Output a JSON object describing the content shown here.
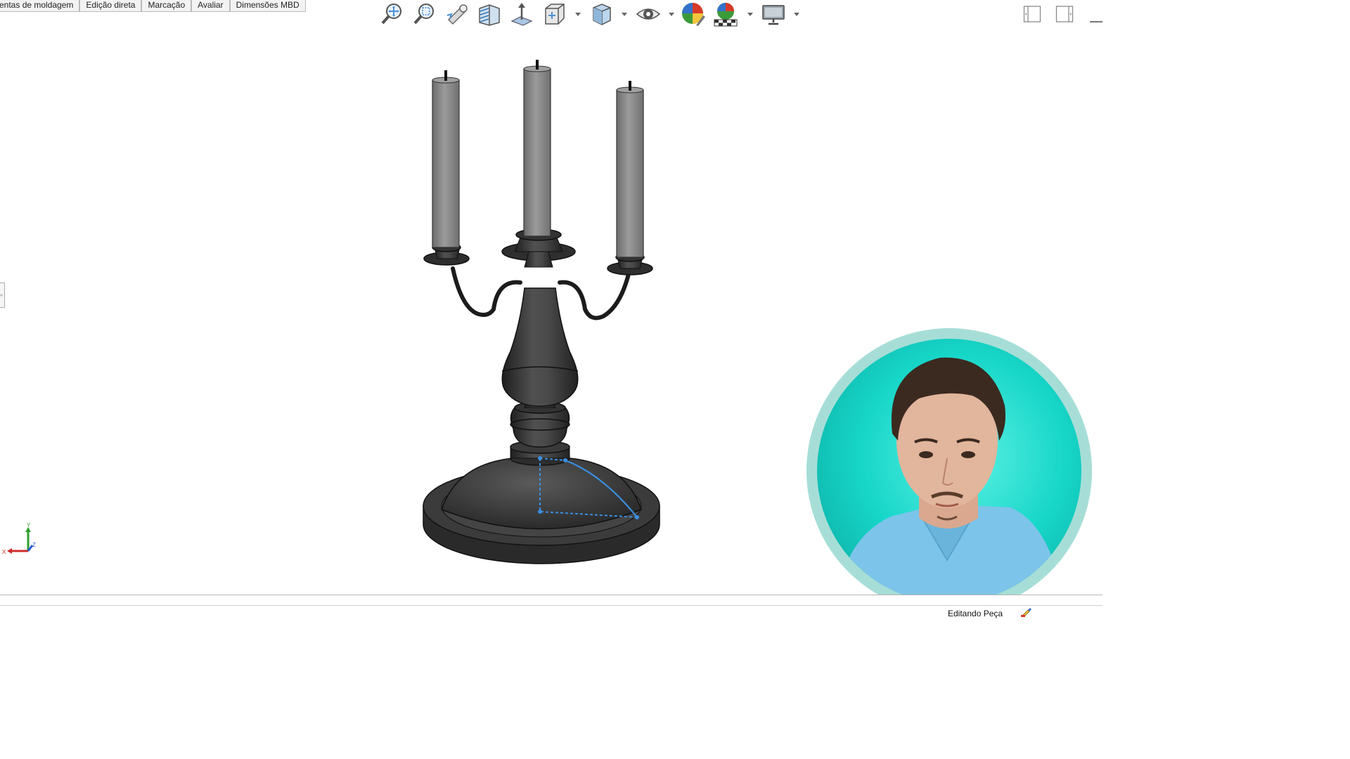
{
  "command_manager": {
    "tabs": [
      {
        "label": "entas de moldagem"
      },
      {
        "label": "Edição direta"
      },
      {
        "label": "Marcação"
      },
      {
        "label": "Avaliar"
      },
      {
        "label": "Dimensões MBD"
      }
    ]
  },
  "heads_up_toolbar": {
    "tools": [
      {
        "icon": "zoom-to-fit-icon"
      },
      {
        "icon": "zoom-to-area-icon"
      },
      {
        "icon": "previous-view-icon"
      },
      {
        "icon": "section-view-icon"
      },
      {
        "icon": "view-selector-icon"
      },
      {
        "icon": "view-orientation-icon"
      },
      {
        "icon": "display-style-icon"
      },
      {
        "icon": "hide-show-items-icon"
      },
      {
        "icon": "edit-appearance-icon"
      },
      {
        "icon": "apply-scene-icon"
      },
      {
        "icon": "view-settings-icon"
      }
    ]
  },
  "colors": {
    "model_body": "#3d3d3d",
    "candle": "#8a8a8a",
    "sketch_highlight": "#3a8fe0",
    "webcam_ring": "#a6ded7",
    "webcam_bg": "#16d6c8"
  },
  "status_bar": {
    "mode_text": "Editando Peça",
    "icon": "rebuild-edit-icon"
  },
  "triad": {
    "x_label": "X",
    "y_label": "Y",
    "z_label": "Z"
  }
}
